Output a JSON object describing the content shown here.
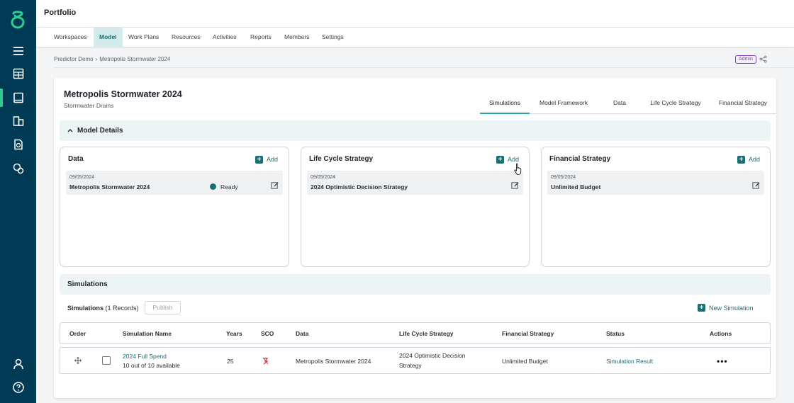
{
  "app": {
    "title": "Portfolio"
  },
  "sidebar": {
    "top_icons": [
      "menu-icon",
      "dashboard-icon",
      "book-icon",
      "buildings-icon",
      "report-icon",
      "settings-cog-icon"
    ],
    "bottom_icons": [
      "user-icon",
      "help-icon"
    ],
    "active_index": 2
  },
  "nav": {
    "items": [
      {
        "label": "Workspaces"
      },
      {
        "label": "Model"
      },
      {
        "label": "Work Plans"
      },
      {
        "label": "Resources"
      },
      {
        "label": "Activities"
      },
      {
        "label": "Reports"
      },
      {
        "label": "Members"
      },
      {
        "label": "Settings"
      }
    ],
    "active": "Model"
  },
  "breadcrumb": {
    "items": [
      "Predictor Demo",
      "Metropolis Stormwater 2024"
    ],
    "separator": "›"
  },
  "role_badge": "Admin",
  "model": {
    "title": "Metropolis Stormwater 2024",
    "subtitle": "Stormwater Drains"
  },
  "tabs": [
    {
      "label": "Simulations"
    },
    {
      "label": "Model Framework"
    },
    {
      "label": "Data"
    },
    {
      "label": "Life Cycle Strategy"
    },
    {
      "label": "Financial Strategy"
    }
  ],
  "model_details": {
    "heading": "Model Details",
    "add_label": "Add",
    "panels": [
      {
        "title": "Data",
        "date": "09/05/2024",
        "name": "Metropolis Stormwater 2024",
        "status": "Ready"
      },
      {
        "title": "Life Cycle Strategy",
        "date": "09/05/2024",
        "name": "2024 Optimistic Decision Strategy"
      },
      {
        "title": "Financial Strategy",
        "date": "09/05/2024",
        "name": "Unlimited Budget"
      }
    ]
  },
  "simulations": {
    "heading": "Simulations",
    "count_label": "Simulations",
    "count_text": "(1 Records)",
    "publish_label": "Publish",
    "new_label": "New Simulation",
    "columns": [
      "Order",
      "Simulation Name",
      "Years",
      "SCO",
      "Data",
      "Life Cycle Strategy",
      "Financial Strategy",
      "Status",
      "Actions"
    ],
    "rows": [
      {
        "name": "2024 Full Spend",
        "availability": "10 out of 10 available",
        "years": "25",
        "data": "Metropolis Stormwater 2024",
        "lcs_line1": "2024 Optimistic Decision",
        "lcs_line2": "Strategy",
        "financial": "Unlimited Budget",
        "status": "Simulation Result",
        "actions": "•••"
      }
    ]
  },
  "colors": {
    "sidebar": "#003a54",
    "accent": "#1c6f72",
    "active_tab": "#2aa4a8",
    "badge": "#7a3fb5",
    "sco": "#d0342c"
  }
}
